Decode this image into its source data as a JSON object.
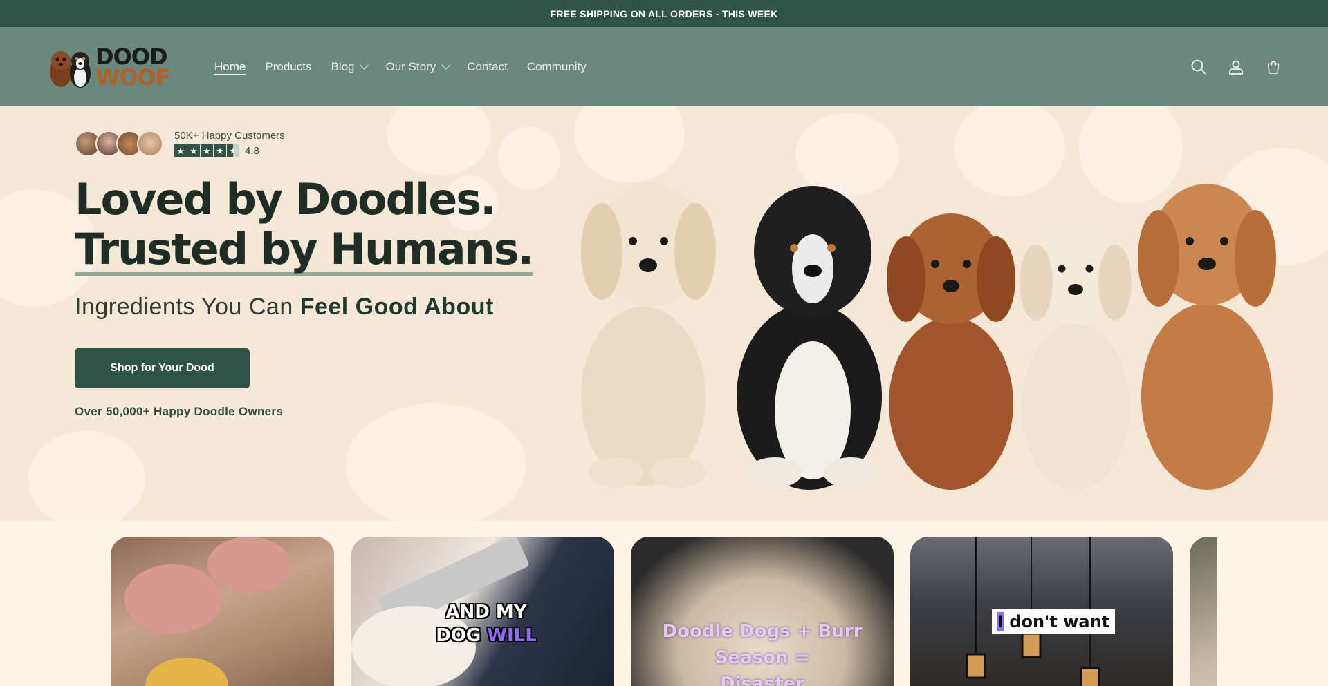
{
  "announcement": "FREE SHIPPING ON ALL ORDERS - THIS WEEK",
  "logo": {
    "line1": "DOOD",
    "line2": "WOOF"
  },
  "nav": [
    {
      "label": "Home",
      "active": true,
      "dropdown": false
    },
    {
      "label": "Products",
      "active": false,
      "dropdown": false
    },
    {
      "label": "Blog",
      "active": false,
      "dropdown": true
    },
    {
      "label": "Our Story",
      "active": false,
      "dropdown": true
    },
    {
      "label": "Contact",
      "active": false,
      "dropdown": false
    },
    {
      "label": "Community",
      "active": false,
      "dropdown": false
    }
  ],
  "header_icons": [
    "search-icon",
    "account-icon",
    "cart-icon"
  ],
  "hero": {
    "customers": "50K+ Happy Customers",
    "rating": "4.8",
    "rating_stars": 4.5,
    "headline_line1": "Loved by Doodles.",
    "headline_line2": "Trusted by Humans.",
    "subhead_prefix": "Ingredients You Can ",
    "subhead_bold": "Feel Good About",
    "cta": "Shop for Your Dood",
    "owners": "Over 50,000+ Happy Doodle Owners"
  },
  "video_cards": [
    {
      "caption": ""
    },
    {
      "caption_line1": "AND MY",
      "caption_line2a": "DOG ",
      "caption_line2b": "WILL"
    },
    {
      "caption_line1": "Doodle Dogs + Burr Season =",
      "caption_line2": "Disaster"
    },
    {
      "caption_cursor": "I",
      "caption": " don't want"
    },
    {
      "caption": ""
    }
  ],
  "colors": {
    "brand": "#2f5447",
    "header": "#6a887d",
    "hero_bg": "#f6e8d7",
    "accent_purple": "#7b5cf0"
  }
}
